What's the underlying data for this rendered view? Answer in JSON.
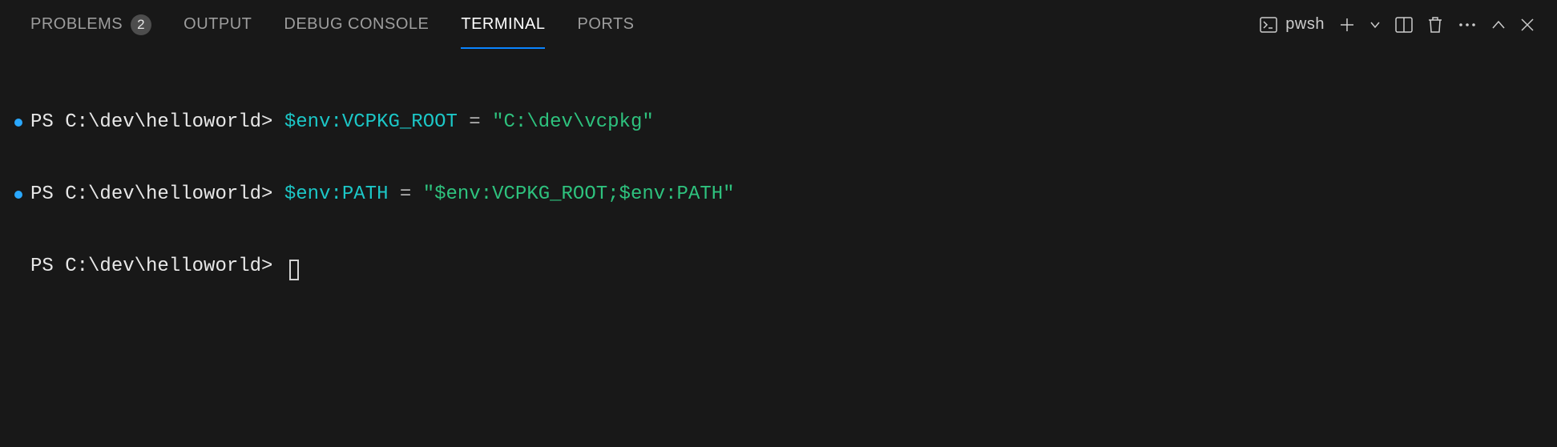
{
  "tabs": {
    "problems": {
      "label": "PROBLEMS",
      "badge": "2"
    },
    "output": {
      "label": "OUTPUT"
    },
    "debug": {
      "label": "DEBUG CONSOLE"
    },
    "terminal": {
      "label": "TERMINAL",
      "active": true
    },
    "ports": {
      "label": "PORTS"
    }
  },
  "toolbar": {
    "shell": "pwsh"
  },
  "terminal": {
    "prompt": "PS C:\\dev\\helloworld> ",
    "lines": [
      {
        "hasBullet": true,
        "var": "$env:VCPKG_ROOT",
        "op": " = ",
        "str": "\"C:\\dev\\vcpkg\""
      },
      {
        "hasBullet": true,
        "var": "$env:PATH",
        "op": " = ",
        "str": "\"$env:VCPKG_ROOT;$env:PATH\""
      }
    ]
  }
}
